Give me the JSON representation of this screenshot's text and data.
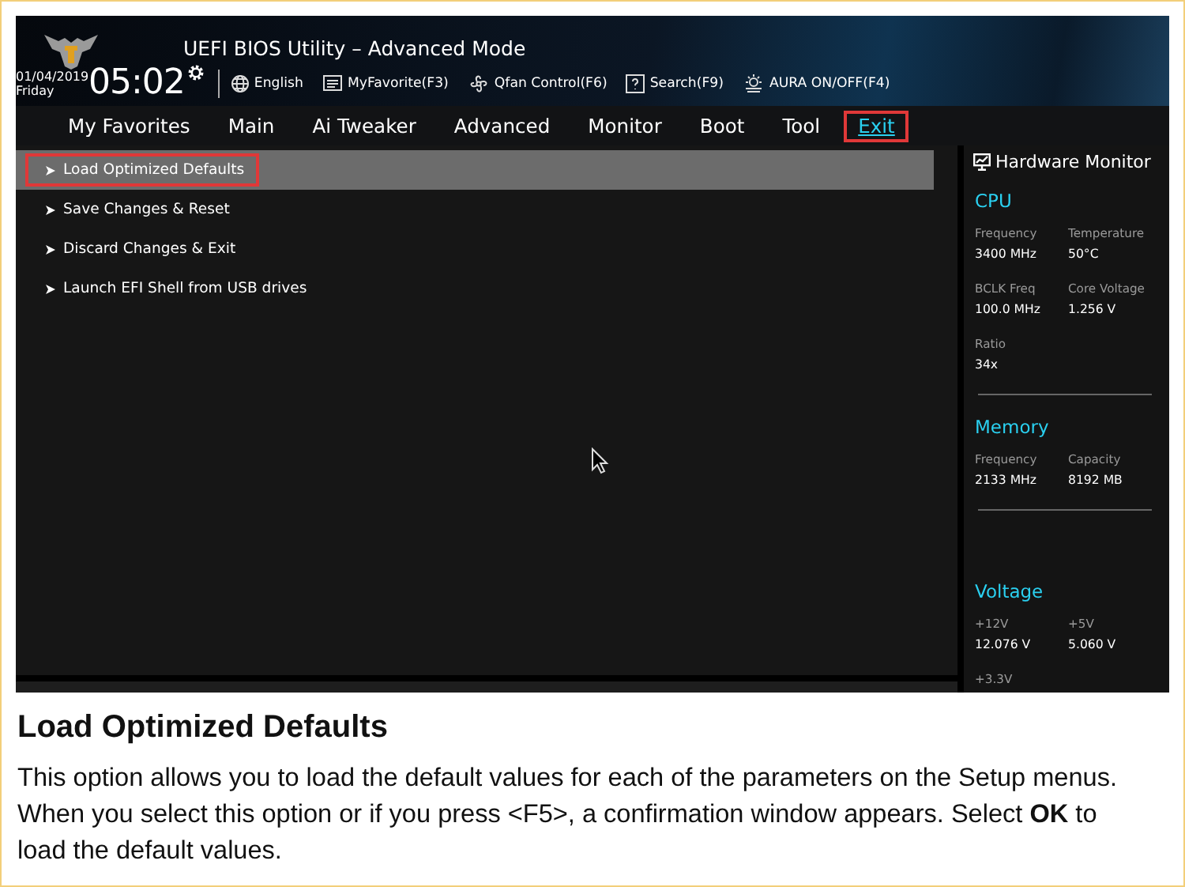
{
  "window": {
    "title": "UEFI BIOS Utility – Advanced Mode"
  },
  "header": {
    "date": "01/04/2019",
    "day": "Friday",
    "time": "05:02",
    "tools": [
      {
        "kind": "globe",
        "label": "English"
      },
      {
        "kind": "favorite",
        "label": "MyFavorite(F3)"
      },
      {
        "kind": "fan",
        "label": "Qfan Control(F6)"
      },
      {
        "kind": "search",
        "label": "Search(F9)"
      },
      {
        "kind": "aura",
        "label": "AURA ON/OFF(F4)"
      }
    ]
  },
  "tabs": [
    {
      "label": "My Favorites",
      "selected": false
    },
    {
      "label": "Main",
      "selected": false
    },
    {
      "label": "Ai Tweaker",
      "selected": false
    },
    {
      "label": "Advanced",
      "selected": false
    },
    {
      "label": "Monitor",
      "selected": false
    },
    {
      "label": "Boot",
      "selected": false
    },
    {
      "label": "Tool",
      "selected": false
    },
    {
      "label": "Exit",
      "selected": true
    }
  ],
  "menu": [
    {
      "label": "Load Optimized Defaults",
      "selected": true
    },
    {
      "label": "Save Changes & Reset",
      "selected": false
    },
    {
      "label": "Discard Changes & Exit",
      "selected": false
    },
    {
      "label": "Launch EFI Shell from USB drives",
      "selected": false
    }
  ],
  "hardware_monitor": {
    "title": "Hardware Monitor",
    "sections": [
      {
        "title": "CPU",
        "items": [
          {
            "label": "Frequency",
            "value": "3400 MHz"
          },
          {
            "label": "Temperature",
            "value": "50°C"
          },
          {
            "label": "BCLK Freq",
            "value": "100.0 MHz"
          },
          {
            "label": "Core Voltage",
            "value": "1.256 V"
          },
          {
            "label": "Ratio",
            "value": "34x"
          }
        ]
      },
      {
        "title": "Memory",
        "items": [
          {
            "label": "Frequency",
            "value": "2133 MHz"
          },
          {
            "label": "Capacity",
            "value": "8192 MB"
          }
        ]
      },
      {
        "title": "Voltage",
        "items": [
          {
            "label": "+12V",
            "value": "12.076 V"
          },
          {
            "label": "+5V",
            "value": "5.060 V"
          },
          {
            "label": "+3.3V"
          }
        ]
      }
    ]
  },
  "caption": {
    "heading": "Load Optimized Defaults",
    "text": "This option allows you to load the default values for each of the parameters on the Setup menus. When you select this option or if you press <F5>, a confirmation window appears. Select **OK** to load the default values."
  }
}
